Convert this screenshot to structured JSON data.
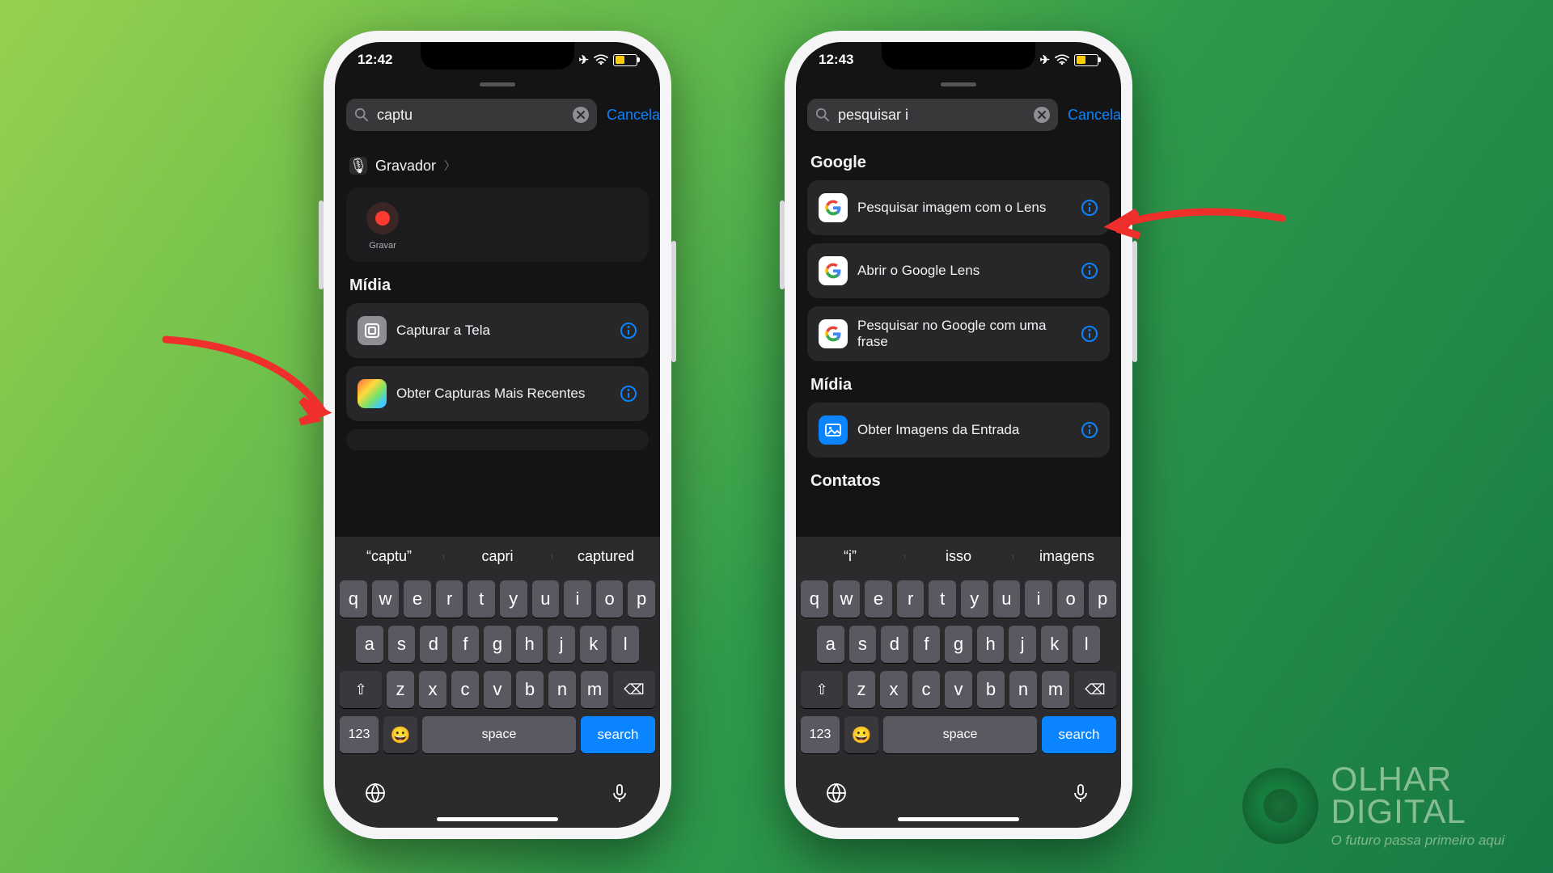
{
  "brand": {
    "line1": "OLHAR",
    "line2": "DIGITAL",
    "tagline": "O futuro passa primeiro aqui"
  },
  "common": {
    "cancel": "Cancelar",
    "space": "space",
    "search_key": "search",
    "num_key": "123",
    "sect_midia": "Mídia",
    "sect_google": "Google",
    "sect_contatos": "Contatos"
  },
  "p1": {
    "time": "12:42",
    "query": "captu",
    "app_label": "Gravador",
    "record_label": "Gravar",
    "row_capturar": "Capturar a Tela",
    "row_obter_capturas": "Obter Capturas Mais Recentes",
    "suggest": [
      "“captu”",
      "capri",
      "captured"
    ]
  },
  "p2": {
    "time": "12:43",
    "query": "pesquisar i",
    "row_lens": "Pesquisar imagem com o Lens",
    "row_abrir_lens": "Abrir o Google Lens",
    "row_google_frase": "Pesquisar no Google com uma frase",
    "row_obter_imagens": "Obter Imagens da Entrada",
    "suggest": [
      "“i”",
      "isso",
      "imagens"
    ]
  }
}
